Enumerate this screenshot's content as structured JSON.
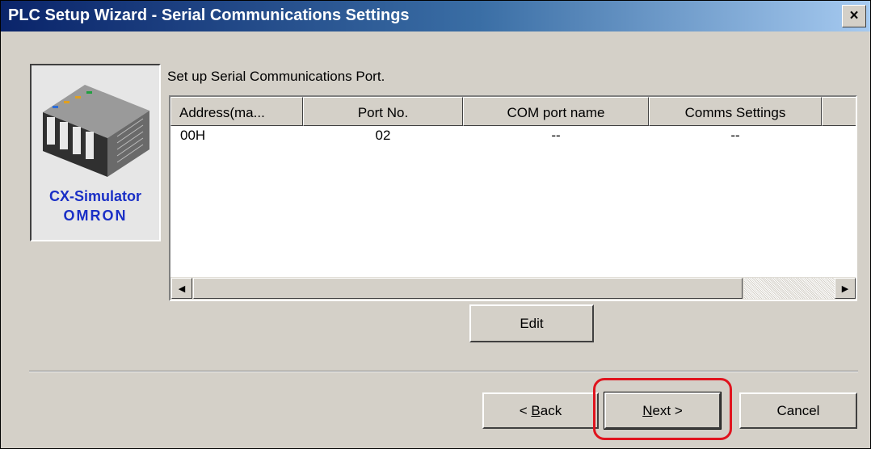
{
  "window": {
    "title": "PLC Setup Wizard - Serial Communications Settings",
    "close_glyph": "×"
  },
  "logo": {
    "product": "CX-Simulator",
    "brand": "OMRON"
  },
  "instruction": "Set up Serial Communications Port.",
  "table": {
    "columns": [
      "Address(ma...",
      "Port No.",
      "COM port name",
      "Comms Settings"
    ],
    "rows": [
      [
        "00H",
        "02",
        "--",
        "--"
      ]
    ]
  },
  "scrollbar": {
    "left_arrow": "◀",
    "right_arrow": "▶"
  },
  "buttons": {
    "edit": "Edit",
    "back_prefix": "< ",
    "back_access": "B",
    "back_rest": "ack",
    "next_access": "N",
    "next_rest": "ext >",
    "cancel": "Cancel"
  },
  "colors": {
    "highlight": "#e0141e",
    "brand_blue": "#1a2fc6"
  }
}
